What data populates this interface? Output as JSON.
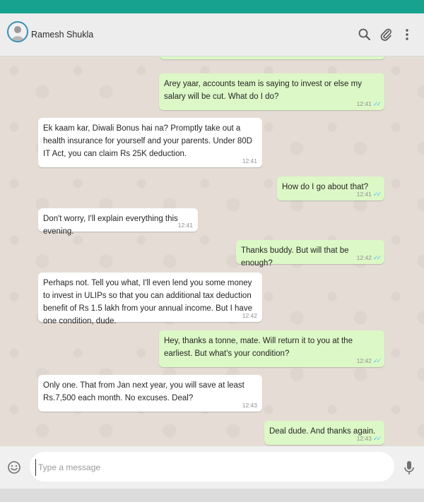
{
  "header": {
    "contact_name": "Ramesh Shukla",
    "icons": [
      "search-icon",
      "attach-icon",
      "menu-icon"
    ]
  },
  "colors": {
    "topbar": "#17a290",
    "outgoing_bubble": "#dcf8c6",
    "incoming_bubble": "#ffffff",
    "read_ticks": "#4fc3f7"
  },
  "messages": [
    {
      "direction": "out",
      "text": "Arey yaar, accounts team is saying to invest or else my salary will be cut. What do I do?",
      "time": "12:41",
      "status": "read"
    },
    {
      "direction": "in",
      "text": "Ek kaam kar, Diwali Bonus hai na? Promptly take out a health insurance for yourself and your parents. Under 80D IT Act, you can claim Rs 25K deduction.",
      "time": "12:41"
    },
    {
      "direction": "out",
      "text": "How do I go about that?",
      "time": "12:41",
      "status": "read"
    },
    {
      "direction": "in",
      "text": "Don't worry, I'll explain everything this evening.",
      "time": "12:41"
    },
    {
      "direction": "out",
      "text": "Thanks buddy. But will that be enough?",
      "time": "12:42",
      "status": "read"
    },
    {
      "direction": "in",
      "text": "Perhaps not. Tell you what, I'll even lend you some money to invest in ULIPs so that you can additional tax deduction benefit of Rs 1.5 lakh from your annual income. But I have one condition, dude.",
      "time": "12:42"
    },
    {
      "direction": "out",
      "text": "Hey, thanks a tonne, mate. Will return it to you at the earliest. But what's your condition?",
      "time": "12:42",
      "status": "read"
    },
    {
      "direction": "in",
      "text": "Only one. That from Jan next year, you will save at least Rs.7,500 each month. No excuses. Deal?",
      "time": "12:43"
    },
    {
      "direction": "out",
      "text": "Deal dude. And thanks again.",
      "time": "12:43",
      "status": "read"
    }
  ],
  "composer": {
    "placeholder": "Type a message",
    "icons": [
      "emoji-icon",
      "microphone-icon"
    ]
  }
}
